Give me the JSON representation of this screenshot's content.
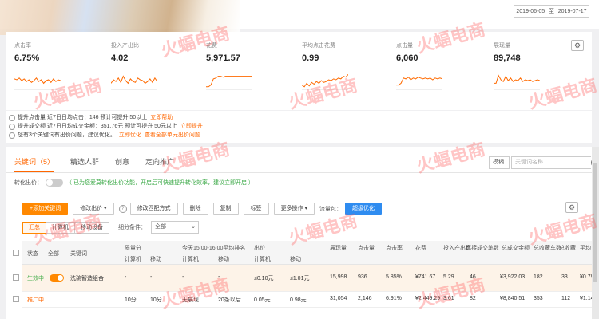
{
  "header": {
    "date_start": "2019-06-05",
    "date_sep": "至",
    "date_end": "2019-07-17"
  },
  "metrics": [
    {
      "label": "点击率",
      "value": "6.75%",
      "trend": [
        0.55,
        0.5,
        0.6,
        0.45,
        0.55,
        0.4,
        0.5,
        0.35,
        0.45,
        0.6,
        0.4,
        0.5,
        0.3,
        0.45,
        0.5,
        0.35,
        0.55,
        0.4,
        0.5,
        0.45
      ]
    },
    {
      "label": "投入产出比",
      "value": "4.02",
      "trend": [
        0.3,
        0.5,
        0.4,
        0.6,
        0.35,
        0.7,
        0.45,
        0.3,
        0.55,
        0.4,
        0.35,
        0.6,
        0.5,
        0.45,
        0.3,
        0.4,
        0.55,
        0.35,
        0.6,
        0.4
      ]
    },
    {
      "label": "花费",
      "value": "5,971.57",
      "trend": [
        0.1,
        0.1,
        0.2,
        0.55,
        0.6,
        0.7,
        0.7,
        0.65,
        0.7,
        0.7,
        0.7,
        0.7,
        0.7,
        0.7,
        0.7,
        0.7,
        0.7,
        0.7,
        0.7,
        0.7
      ]
    },
    {
      "label": "平均点击花费",
      "value": "0.99",
      "trend": [
        0.2,
        0.1,
        0.3,
        0.15,
        0.35,
        0.25,
        0.4,
        0.3,
        0.45,
        0.35,
        0.4,
        0.5,
        0.45,
        0.55,
        0.5,
        0.6,
        0.55,
        0.7,
        0.65,
        0.8
      ]
    },
    {
      "label": "点击量",
      "value": "6,060",
      "trend": [
        0.2,
        0.2,
        0.3,
        0.6,
        0.55,
        0.65,
        0.5,
        0.6,
        0.55,
        0.65,
        0.6,
        0.55,
        0.6,
        0.55,
        0.6,
        0.5,
        0.6,
        0.55,
        0.6,
        0.55
      ]
    },
    {
      "label": "展现量",
      "value": "89,748",
      "trend": [
        0.3,
        0.3,
        0.75,
        0.5,
        0.4,
        0.7,
        0.45,
        0.6,
        0.4,
        0.5,
        0.45,
        0.6,
        0.4,
        0.5,
        0.45,
        0.5,
        0.4,
        0.45,
        0.5,
        0.45
      ]
    }
  ],
  "colors": {
    "accent": "#ff6600",
    "trend_line": "#ff6a00",
    "green": "#39a845"
  },
  "tips": [
    {
      "text": "提升点击量 近7日日均点击：146   预计可提升 50以上",
      "link": "立即帮助"
    },
    {
      "text": "提升成交额 近7日日均成交金额：351.76元   预计可提升 50元以上",
      "link": "立即提升"
    },
    {
      "text": "您有3个关键词有出价问题，建议优化。",
      "link": "立即优化",
      "extra": "查看全部单元出价问题"
    }
  ],
  "tabs": [
    {
      "label": "关键词（5）"
    },
    {
      "label": "精选人群"
    },
    {
      "label": "创意"
    },
    {
      "label": "定向推广"
    }
  ],
  "filter_select": "模糊",
  "search_placeholder": "关键词名称",
  "convert": {
    "label": "转化出价：",
    "hint": "（ 已为您爱莫转化出价功能，开启后可快速提升转化效率，建议立即开启 ）"
  },
  "toolbar": {
    "add_keyword": "+添加关键词",
    "modify_bid": "修改出价 ▾",
    "modify_match": "修改匹配方式",
    "delete": "删除",
    "copy": "复制",
    "tag": "标签",
    "more": "更多操作 ▾",
    "view_label": "流量包：",
    "optimize": "超级优化"
  },
  "subtoolbar": {
    "segments": [
      "汇总",
      "计算机",
      "移动设备"
    ],
    "filter_label": "细分条件：",
    "filter_value": "全部"
  },
  "table": {
    "headers": {
      "status": "状态",
      "all": "全部",
      "keyword": "关键词",
      "quality": "质量分",
      "quality_pc": "计算机",
      "quality_mobile": "移动",
      "rank": "今天15:00-16:00平均排名",
      "rank_pc": "计算机",
      "rank_mobile": "移动",
      "bid": "出价",
      "bid_pc": "计算机",
      "bid_mobile": "移动",
      "impressions": "展现量",
      "clicks": "点击量",
      "ctr": "点击率",
      "cost": "花费",
      "roi": "投入产出比",
      "direct_orders": "直接成交笔数",
      "total_amount": "总成交金额",
      "fav_count": "总收藏车数",
      "fav_items": "总收藏",
      "avg": "平均"
    },
    "rows": [
      {
        "status": "生效中",
        "keyword": "洗碗智造组合",
        "q_pc": "-",
        "q_m": "-",
        "rank_pc": "-",
        "rank_m": "-",
        "bid_pc": "≤0.10元",
        "bid_m": "≤1.01元",
        "impr": "15,998",
        "clicks": "936",
        "ctr": "5.85%",
        "cost": "¥741.67",
        "roi": "5.29",
        "orders": "46",
        "amount": "¥3,922.03",
        "fav": "182",
        "favi": "33",
        "avg": "¥0.79"
      },
      {
        "status": "推广中",
        "keyword": "",
        "q_pc": "10分",
        "q_m": "10分",
        "rank_pc": "无展现",
        "rank_m": "20条以后",
        "bid_pc": "0.05元",
        "bid_m": "0.98元",
        "impr": "31,054",
        "clicks": "2,146",
        "ctr": "6.91%",
        "cost": "¥2,449.29",
        "roi": "3.61",
        "orders": "82",
        "amount": "¥8,840.51",
        "fav": "353",
        "favi": "112",
        "avg": "¥1.14"
      }
    ]
  },
  "watermark": "火蝠电商"
}
